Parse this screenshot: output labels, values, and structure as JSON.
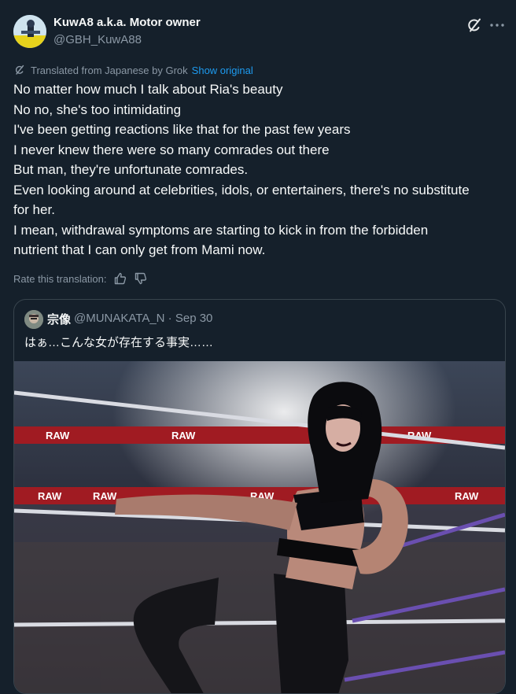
{
  "author": {
    "display_name": "KuwA8 a.k.a. Motor owner",
    "handle": "@GBH_KuwA88"
  },
  "translation": {
    "label": "Translated from Japanese by Grok",
    "show_original": "Show original"
  },
  "body_lines": [
    "No matter how much I talk about Ria's beauty",
    "No no, she's too intimidating",
    "I've been getting reactions like that for the past few years",
    "I never knew there were so many comrades out there",
    "But man, they're unfortunate comrades.",
    "Even looking around at celebrities, idols, or entertainers, there's no substitute",
    "for her.",
    "I mean, withdrawal symptoms are starting to kick in from the forbidden",
    "nutrient that I can only get from Mami now."
  ],
  "rate": {
    "label": "Rate this translation:"
  },
  "quote": {
    "name": "宗像",
    "meta": "@MUNAKATA_N · Sep 30",
    "text": "はぁ…こんな女が存在する事実……"
  },
  "photo": {
    "banners": [
      "RAW",
      "RAW",
      "RAW",
      "RAW",
      "RAW",
      "RAW",
      "RAW"
    ]
  },
  "icons": {
    "grok": "grok-icon",
    "more": "more-icon",
    "translate": "translate-icon",
    "thumbs_up": "thumbs-up-icon",
    "thumbs_down": "thumbs-down-icon"
  },
  "colors": {
    "background": "#15202b",
    "text": "#f7f9f9",
    "secondary": "#8b98a5",
    "accent": "#1d9bf0",
    "border": "#38444d"
  }
}
